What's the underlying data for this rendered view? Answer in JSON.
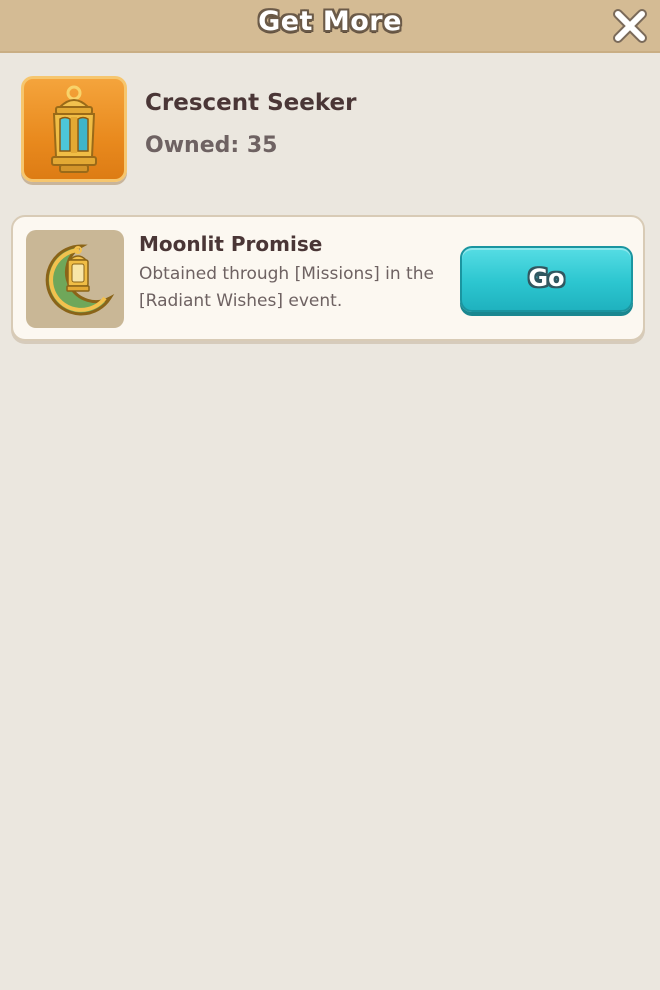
{
  "header": {
    "title": "Get More",
    "close_icon": "close-icon"
  },
  "item": {
    "name": "Crescent Seeker",
    "owned_label": "Owned: 35",
    "icon": "lantern-icon",
    "frame_color": "#e98a1e"
  },
  "sources": [
    {
      "title": "Moonlit Promise",
      "description": "Obtained through [Missions] in the [Radiant Wishes] event.",
      "icon": "crescent-lantern-icon",
      "button_label": "Go"
    }
  ],
  "colors": {
    "header_bg": "#d4bb94",
    "page_bg": "#ebe7df",
    "go_button": "#2cc6d0"
  }
}
